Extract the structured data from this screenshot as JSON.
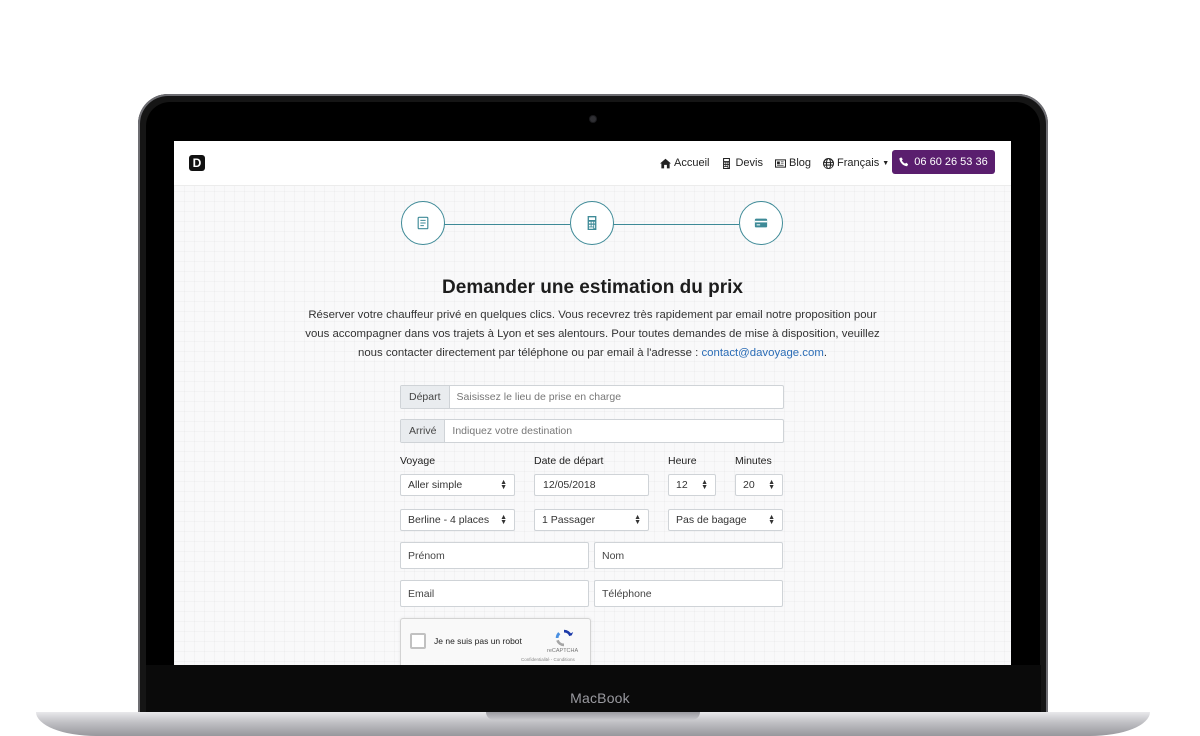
{
  "device": {
    "brand": "MacBook"
  },
  "logo": {
    "letter": "D"
  },
  "nav": {
    "items": [
      {
        "label": "Accueil",
        "icon": "home-icon"
      },
      {
        "label": "Devis",
        "icon": "calculator-icon"
      },
      {
        "label": "Blog",
        "icon": "newspaper-icon"
      },
      {
        "label": "Français",
        "icon": "globe-icon"
      }
    ],
    "phone": "06 60 26 53 36"
  },
  "colors": {
    "accent": "#5a1e6e",
    "step": "#3e8a97",
    "link": "#2a6cb6"
  },
  "steps": [
    {
      "icon": "form-icon"
    },
    {
      "icon": "calculator-icon"
    },
    {
      "icon": "credit-card-icon"
    }
  ],
  "page": {
    "title": "Demander une estimation du prix",
    "intro": "Réserver votre chauffeur privé en quelques clics. Vous recevrez très rapidement par email notre proposition pour vous accompagner dans vos trajets à Lyon et ses alentours. Pour toutes demandes de mise à disposition, veuillez nous contacter directement par téléphone ou par email à l'adresse : ",
    "email": "contact@davoyage.com",
    "intro_end": "."
  },
  "form": {
    "depart": {
      "label": "Départ",
      "placeholder": "Saisissez le lieu de prise en charge"
    },
    "arrive": {
      "label": "Arrivé",
      "placeholder": "Indiquez votre destination"
    },
    "labels": {
      "voyage": "Voyage",
      "date": "Date de départ",
      "heure": "Heure",
      "minutes": "Minutes"
    },
    "voyage": "Aller simple",
    "date": "12/05/2018",
    "heure": "12",
    "minutes": "20",
    "vehicule": "Berline - 4 places",
    "passagers": "1 Passager",
    "bagages": "Pas de bagage",
    "prenom_placeholder": "Prénom",
    "nom_placeholder": "Nom",
    "email_placeholder": "Email",
    "telephone_placeholder": "Téléphone"
  },
  "recaptcha": {
    "label": "Je ne suis pas un robot",
    "brand": "reCAPTCHA",
    "links": "Confidentialité - Conditions"
  }
}
